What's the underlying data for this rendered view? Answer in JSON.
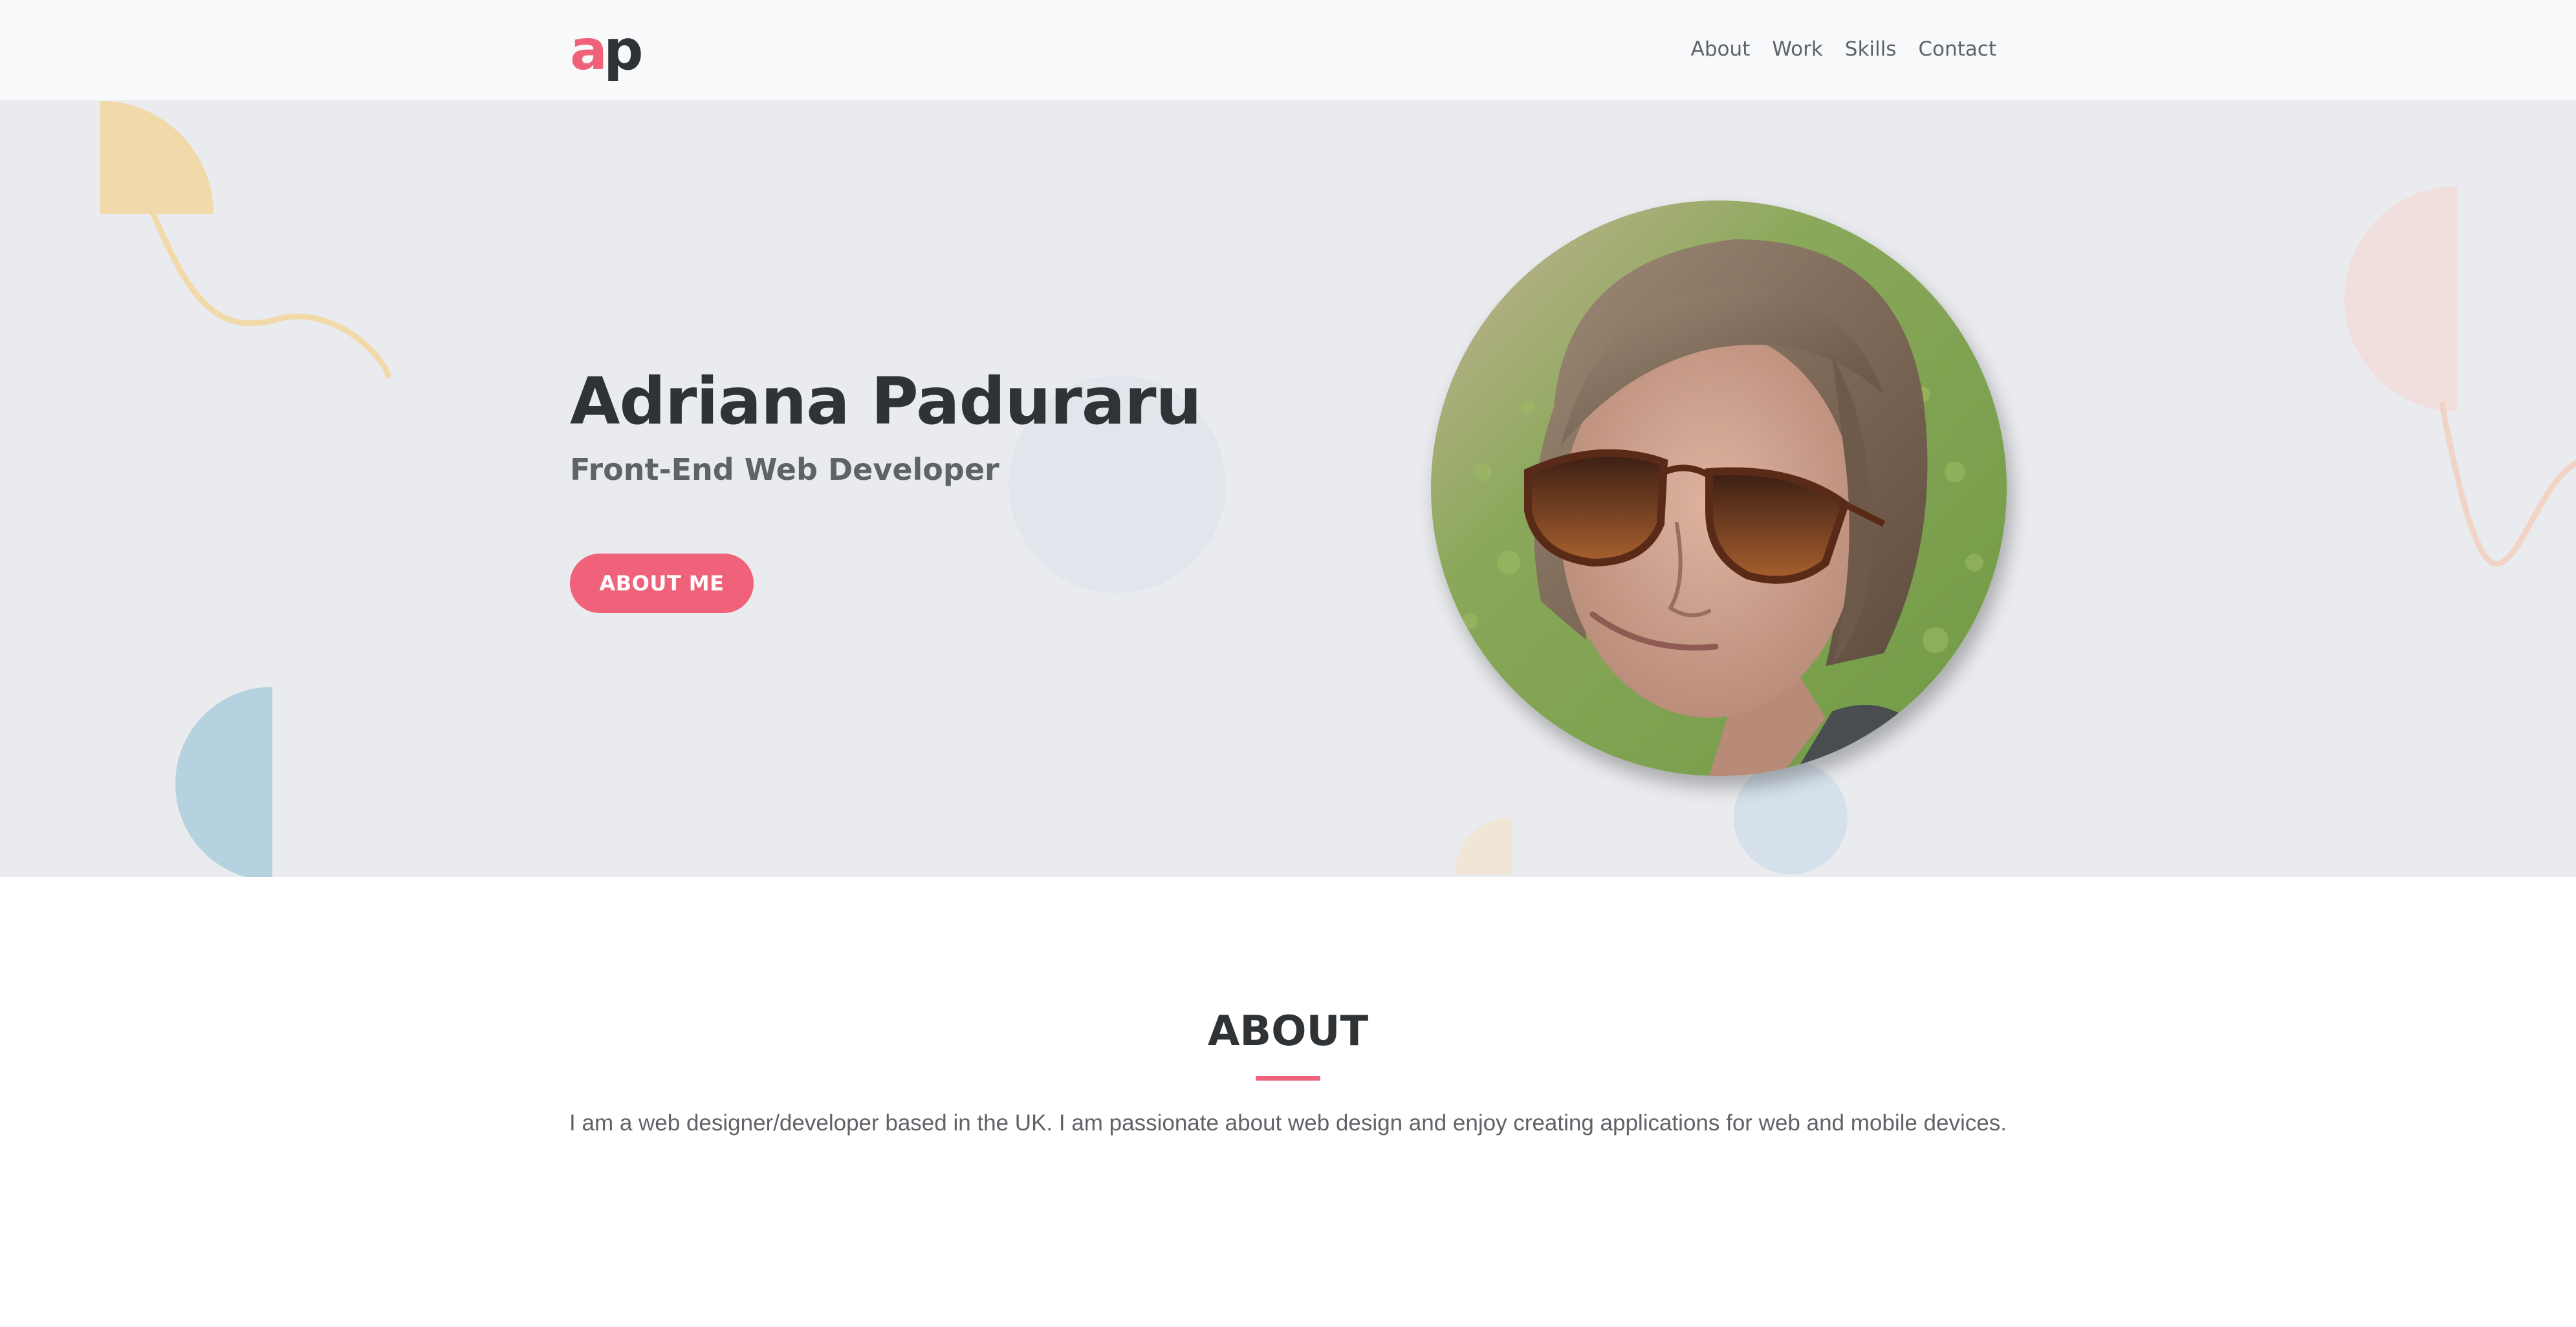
{
  "header": {
    "logo": {
      "first": "a",
      "second": "p"
    },
    "nav": [
      "About",
      "Work",
      "Skills",
      "Contact"
    ]
  },
  "hero": {
    "name": "Adriana Paduraru",
    "title": "Front-End Web Developer",
    "button_label": "ABOUT ME"
  },
  "about": {
    "heading": "ABOUT",
    "text": "I am a web designer/developer based in the UK. I am passionate about web design and enjoy creating applications for web and mobile devices."
  },
  "colors": {
    "accent": "#f0627a",
    "text_dark": "#2f3336",
    "text_muted": "#5f6368",
    "hero_bg": "#e9ebee",
    "header_bg": "#f8f9fb"
  }
}
